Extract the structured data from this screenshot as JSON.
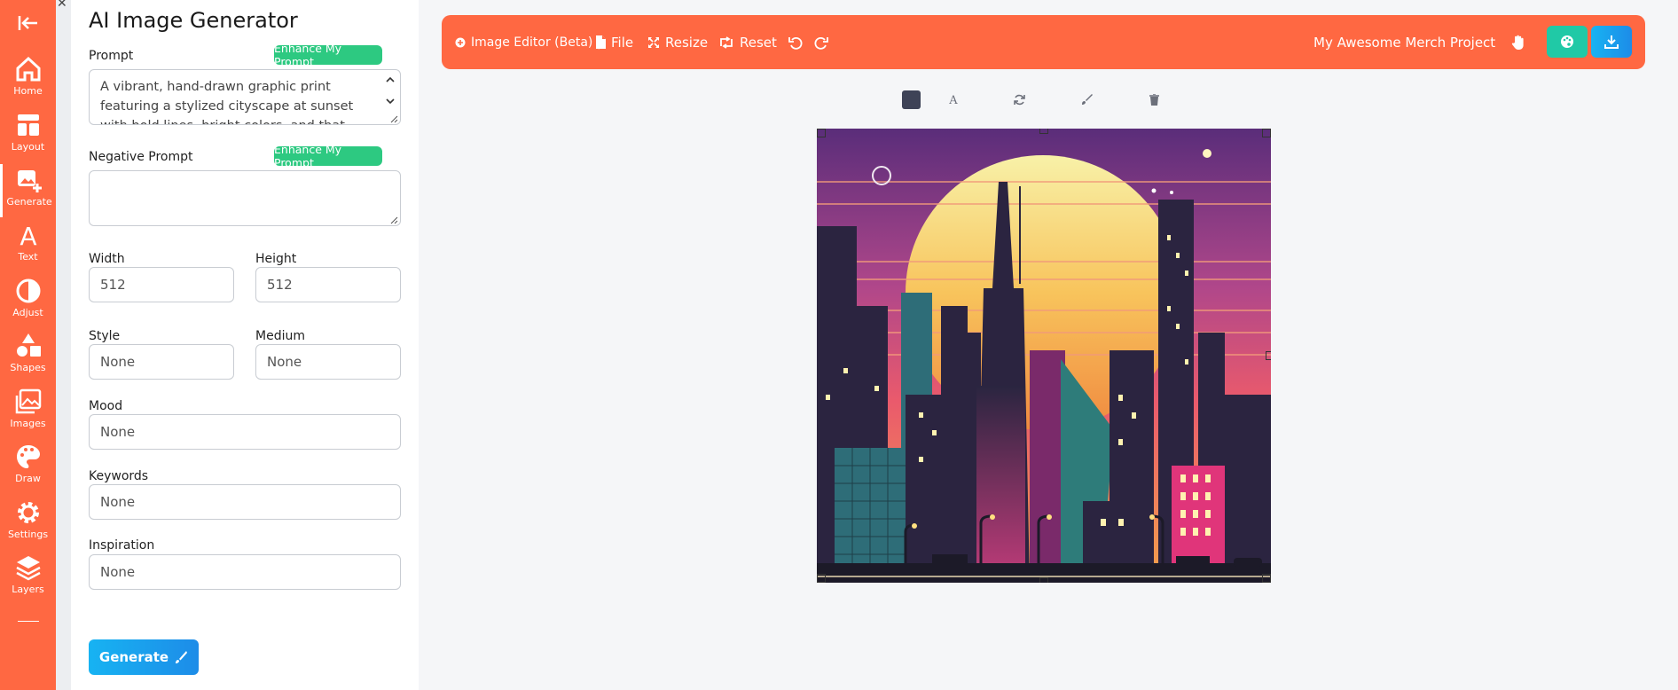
{
  "rail": {
    "items": [
      {
        "label": "Home",
        "icon": "home-icon"
      },
      {
        "label": "Layout",
        "icon": "layout-icon"
      },
      {
        "label": "Generate",
        "icon": "generate-image-icon"
      },
      {
        "label": "Text",
        "icon": "text-icon"
      },
      {
        "label": "Adjust",
        "icon": "adjust-icon"
      },
      {
        "label": "Shapes",
        "icon": "shapes-icon"
      },
      {
        "label": "Images",
        "icon": "images-icon"
      },
      {
        "label": "Draw",
        "icon": "palette-icon"
      },
      {
        "label": "Settings",
        "icon": "gear-icon"
      },
      {
        "label": "Layers",
        "icon": "layers-icon"
      }
    ],
    "active": "Generate"
  },
  "panel": {
    "title": "AI Image Generator",
    "prompt_label": "Prompt",
    "enhance_label": "Enhance My Prompt",
    "prompt_value": "A vibrant, hand-drawn graphic print featuring a stylized cityscape at sunset with bold lines, bright colors, and that text",
    "negative_label": "Negative Prompt",
    "negative_value": "",
    "width_label": "Width",
    "width_value": "512",
    "height_label": "Height",
    "height_value": "512",
    "style_label": "Style",
    "style_value": "None",
    "medium_label": "Medium",
    "medium_value": "None",
    "mood_label": "Mood",
    "mood_value": "None",
    "keywords_label": "Keywords",
    "keywords_value": "None",
    "inspiration_label": "Inspiration",
    "inspiration_value": "None",
    "generate_label": "Generate"
  },
  "toolbar": {
    "editor_label": "Image Editor (Beta) |",
    "file_label": "File",
    "resize_label": "Resize",
    "reset_label": "Reset",
    "project_name": "My Awesome Merch Project"
  },
  "colors": {
    "brand": "#ff6842",
    "accent_green": "#2dc981",
    "accent_teal": "#20c9a6",
    "accent_blue": "#1d8ce8"
  }
}
